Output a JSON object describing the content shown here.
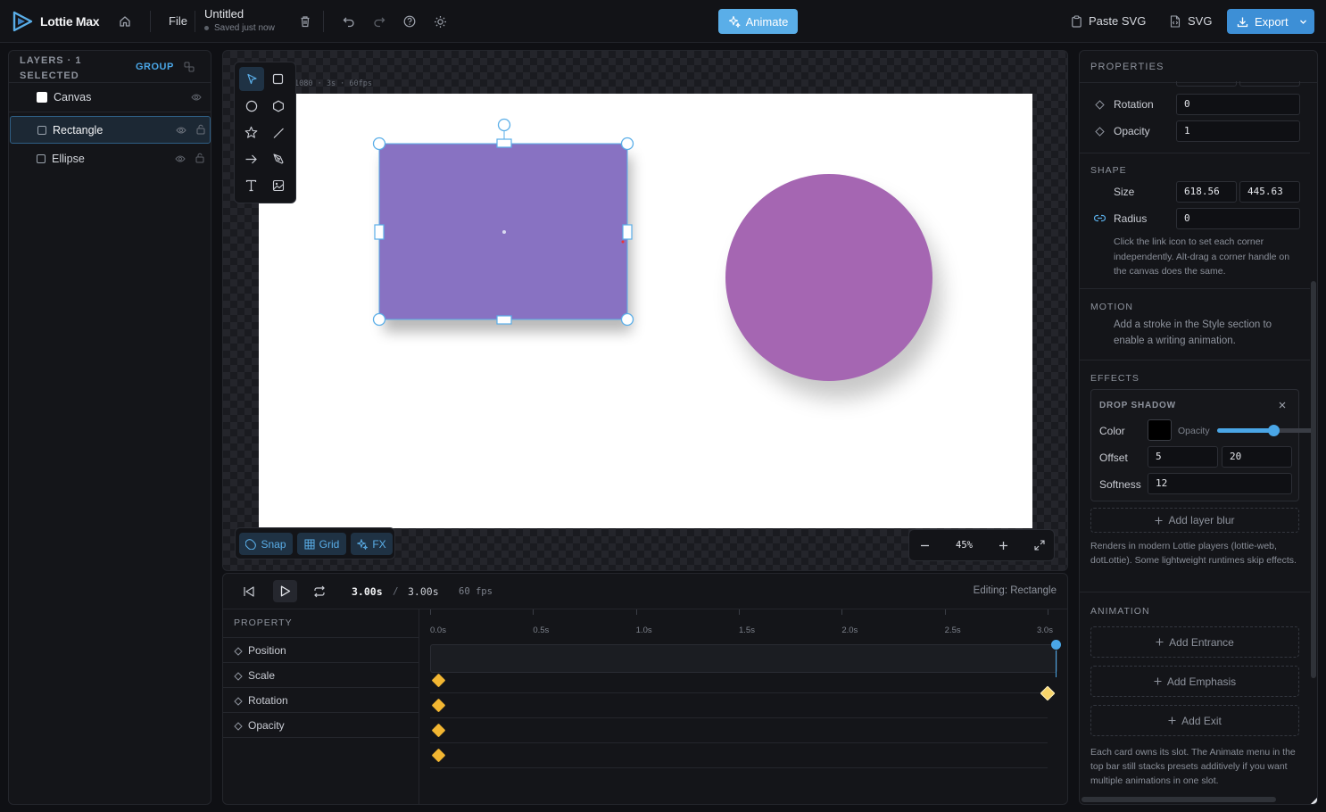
{
  "app": {
    "name": "Lottie Max",
    "file_menu": "File",
    "doc_title": "Untitled",
    "save_status": "Saved just now"
  },
  "topbar": {
    "animate_label": "Animate",
    "paste_svg_label": "Paste SVG",
    "svg_label": "SVG",
    "export_label": "Export"
  },
  "layers": {
    "title": "LAYERS · 1 SELECTED",
    "group_label": "GROUP",
    "items": [
      {
        "label": "Canvas"
      },
      {
        "label": "Rectangle",
        "selected": true
      },
      {
        "label": "Ellipse"
      }
    ]
  },
  "canvas": {
    "info": "1080 · 3s · 60fps",
    "background": "#ffffff",
    "rect_color": "#8872c2",
    "ellipse_color": "#a566b2",
    "snap_label": "Snap",
    "grid_label": "Grid",
    "fx_label": "FX",
    "zoom": "45%"
  },
  "timeline": {
    "current_time": "3.00s",
    "separator": "/",
    "duration": "3.00s",
    "fps": "60 fps",
    "editing": "Editing: Rectangle",
    "property_header": "PROPERTY",
    "properties": [
      "Position",
      "Scale",
      "Rotation",
      "Opacity"
    ],
    "ticks": [
      "0.0s",
      "0.5s",
      "1.0s",
      "1.5s",
      "2.0s",
      "2.5s",
      "3.0s"
    ]
  },
  "properties": {
    "title": "PROPERTIES",
    "rotation_label": "Rotation",
    "rotation_value": "0",
    "opacity_label": "Opacity",
    "opacity_value": "1",
    "shape_title": "SHAPE",
    "size_label": "Size",
    "size_w": "618.56",
    "size_h": "445.63",
    "radius_label": "Radius",
    "radius_value": "0",
    "radius_hint": "Click the link icon to set each corner independently. Alt-drag a corner handle on the canvas does the same.",
    "motion_title": "MOTION",
    "motion_hint": "Add a stroke in the Style section to enable a writing animation.",
    "effects_title": "EFFECTS",
    "drop_shadow_title": "DROP SHADOW",
    "color_label": "Color",
    "shadow_color": "#000000",
    "opacity_slider_label": "Opacity",
    "offset_label": "Offset",
    "offset_x": "5",
    "offset_y": "20",
    "softness_label": "Softness",
    "softness_value": "12",
    "add_layer_blur": "Add layer blur",
    "effects_hint": "Renders in modern Lottie players (lottie-web, dotLottie). Some lightweight runtimes skip effects.",
    "animation_title": "ANIMATION",
    "add_entrance": "Add Entrance",
    "add_emphasis": "Add Emphasis",
    "add_exit": "Add Exit",
    "animation_hint": "Each card owns its slot. The Animate menu in the top bar still stacks presets additively if you want multiple animations in one slot."
  },
  "colors": {
    "accent": "#4a9fe0",
    "animate_btn": "#5aaee8",
    "keyframe": "#f2b632"
  }
}
